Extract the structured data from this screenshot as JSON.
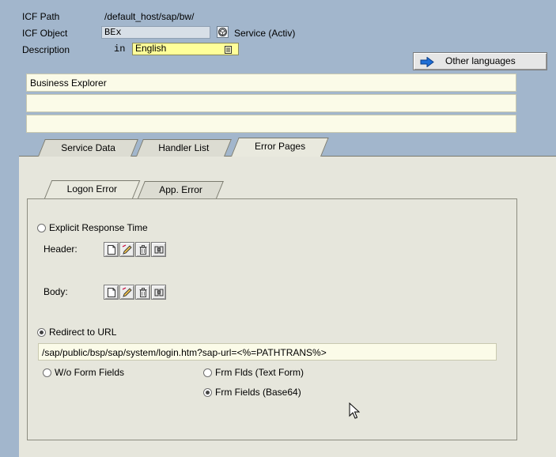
{
  "header": {
    "icf_path_label": "ICF Path",
    "icf_path_value": "/default_host/sap/bw/",
    "icf_object_label": "ICF Object",
    "icf_object_value": "BEx",
    "service_status": "Service (Activ)",
    "description_label": "Description",
    "in_label": "in",
    "language_value": "English",
    "other_languages_label": "Other languages",
    "description_lines": [
      "Business Explorer",
      "",
      ""
    ]
  },
  "tabs": [
    {
      "label": "Service Data"
    },
    {
      "label": "Handler List"
    },
    {
      "label": "Error Pages"
    }
  ],
  "subtabs": [
    {
      "label": "Logon Error"
    },
    {
      "label": "App. Error"
    }
  ],
  "error_pages": {
    "explicit_response_label": "Explicit Response Time",
    "header_label": "Header:",
    "body_label": "Body:",
    "redirect_label": "Redirect to URL",
    "redirect_url": "/sap/public/bsp/sap/system/login.htm?sap-url=<%=PATHTRANS%>",
    "wo_form_fields_label": "W/o Form Fields",
    "frm_flds_text_label": "Frm Flds (Text Form)",
    "frm_fields_base64_label": "Frm Fields (Base64)"
  },
  "colors": {
    "background": "#a2b6cc",
    "panel": "#e6e6dc",
    "highlight_field": "#ffff99"
  }
}
